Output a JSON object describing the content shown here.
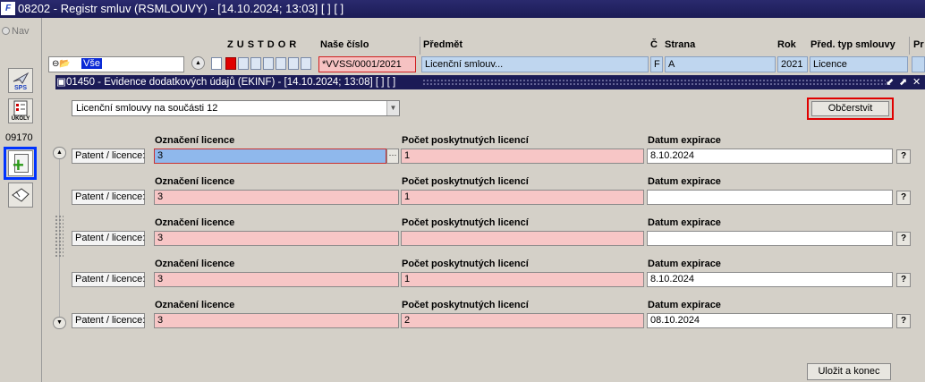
{
  "main_window": {
    "logo_text": "F",
    "title": "08202 - Registr smluv (RSMLOUVY) - [14.10.2024; 13:03]  [ ]  [ ]"
  },
  "nav": {
    "label": "Nav"
  },
  "toolbar": {
    "sps_label": "SPS",
    "ukoly_label": "ÚKOLY",
    "code": "09170",
    "icons": [
      "plane-icon",
      "tasks-icon",
      "add-document-icon",
      "hand-icon"
    ]
  },
  "grid_header": {
    "flags": [
      "Z",
      "U",
      "S",
      "T",
      "D",
      "O",
      "R"
    ],
    "columns": [
      "Naše číslo",
      "Předmět",
      "Č",
      "Strana",
      "Rok",
      "Před. typ smlouvy",
      "Pr"
    ]
  },
  "grid_row": {
    "tree_label": "Vše",
    "nase_cislo": "*VVSS/0001/2021",
    "predmet": "Licenční smlouv...",
    "c": "F",
    "strana": "A",
    "rok": "2021",
    "typ": "Licence"
  },
  "inner_window": {
    "title": "01450 - Evidence dodatkových údajů (EKINF) - [14.10.2024; 13:08]  [ ]  [ ]",
    "controls": [
      "⬋",
      "⬈",
      "✕"
    ],
    "combo_value": "Licenční smlouvy na součásti 12",
    "refresh_label": "Občerstvit",
    "save_label": "Uložit a konec"
  },
  "records": {
    "labels": {
      "oznaceni": "Označení licence",
      "pocet": "Počet poskytnutých licencí",
      "datum": "Datum expirace",
      "patent": "Patent / licence:",
      "help": "?",
      "ellipsis": "···"
    },
    "rows": [
      {
        "oznaceni": "3",
        "pocet": "1",
        "datum": "8.10.2024"
      },
      {
        "oznaceni": "3",
        "pocet": "1",
        "datum": ""
      },
      {
        "oznaceni": "3",
        "pocet": "",
        "datum": ""
      },
      {
        "oznaceni": "3",
        "pocet": "1",
        "datum": "8.10.2024"
      },
      {
        "oznaceni": "3",
        "pocet": "2",
        "datum": "08.10.2024"
      }
    ]
  }
}
